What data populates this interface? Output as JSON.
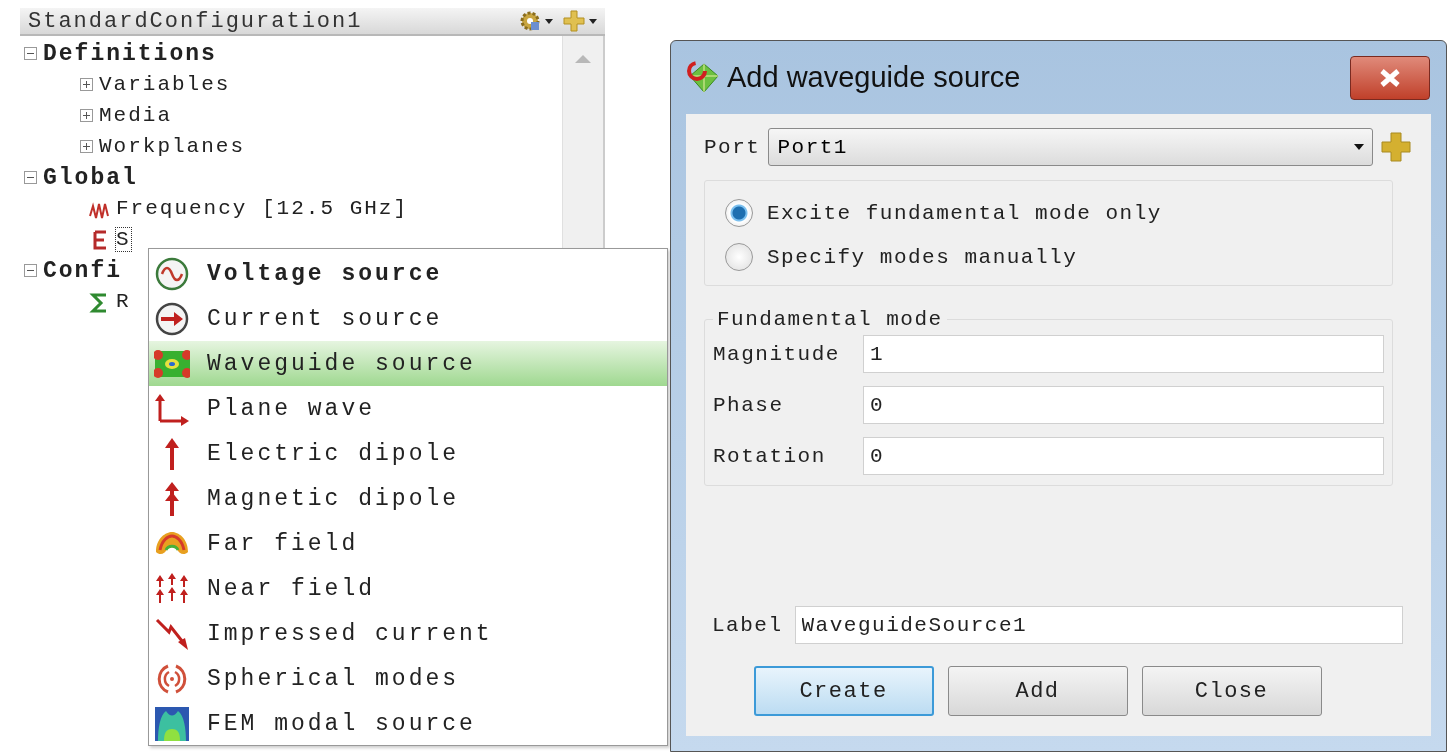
{
  "panel": {
    "title": "StandardConfiguration1"
  },
  "tree": [
    {
      "label": "Definitions",
      "expanded": true,
      "selected": false,
      "children": [
        {
          "label": "Variables",
          "expanded": false,
          "selected": false
        },
        {
          "label": "Media",
          "expanded": false,
          "selected": false
        },
        {
          "label": "Workplanes",
          "expanded": false,
          "selected": false
        }
      ]
    },
    {
      "label": "Global",
      "expanded": true,
      "selected": false,
      "children": [
        {
          "label": "Frequency [12.5 GHz]",
          "kind": "frequency",
          "selected": false
        },
        {
          "label": "S",
          "kind": "sources",
          "selected": true
        }
      ]
    },
    {
      "label": "Confi",
      "expanded": true,
      "selected": false,
      "children": [
        {
          "label": "R",
          "kind": "results",
          "selected": false
        }
      ]
    }
  ],
  "menu": [
    {
      "label": "Voltage source",
      "kind": "voltage",
      "default": true,
      "selected": false
    },
    {
      "label": "Current source",
      "kind": "current",
      "default": false,
      "selected": false
    },
    {
      "label": "Waveguide source",
      "kind": "waveguide",
      "default": false,
      "selected": true
    },
    {
      "label": "Plane wave",
      "kind": "plane",
      "default": false,
      "selected": false
    },
    {
      "label": "Electric dipole",
      "kind": "electric",
      "default": false,
      "selected": false
    },
    {
      "label": "Magnetic dipole",
      "kind": "magnetic",
      "default": false,
      "selected": false
    },
    {
      "label": "Far field",
      "kind": "far",
      "default": false,
      "selected": false
    },
    {
      "label": "Near field",
      "kind": "near",
      "default": false,
      "selected": false
    },
    {
      "label": "Impressed current",
      "kind": "impressed",
      "default": false,
      "selected": false
    },
    {
      "label": "Spherical modes",
      "kind": "spherical",
      "default": false,
      "selected": false
    },
    {
      "label": "FEM modal source",
      "kind": "fem",
      "default": false,
      "selected": false
    }
  ],
  "dialog": {
    "title": "Add waveguide source",
    "port": {
      "label": "Port",
      "value": "Port1"
    },
    "modes": [
      {
        "label": "Excite fundamental mode only",
        "selected": true
      },
      {
        "label": "Specify modes manually",
        "selected": false
      }
    ],
    "group": {
      "title": "Fundamental mode",
      "fields": [
        {
          "label": "Magnitude",
          "value": "1"
        },
        {
          "label": "Phase",
          "value": "0"
        },
        {
          "label": "Rotation",
          "value": "0"
        }
      ]
    },
    "label_field": {
      "label": "Label",
      "value": "WaveguideSource1"
    },
    "buttons": [
      {
        "label": "Create",
        "default": true
      },
      {
        "label": "Add",
        "default": false
      },
      {
        "label": "Close",
        "default": false
      }
    ]
  }
}
